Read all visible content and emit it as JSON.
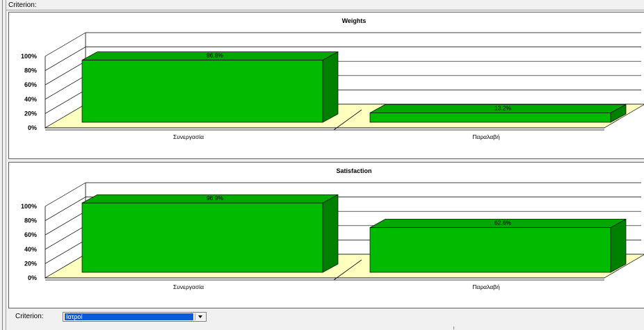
{
  "header": {
    "criterion_label": "Criterion:"
  },
  "footer": {
    "criterion_label": "Criterion:",
    "criterion_value": "Ιατροί"
  },
  "colors": {
    "bar_front": "#00bb00",
    "bar_top": "#00a800",
    "bar_side": "#008000",
    "floor": "#ffffc0"
  },
  "chart_data": [
    {
      "type": "bar",
      "title": "Weights",
      "categories": [
        "Συνεργασία",
        "Παραλαβή"
      ],
      "values": [
        86.8,
        13.2
      ],
      "data_labels": [
        "86.8%",
        "13.2%"
      ],
      "y_ticks": [
        "0%",
        "20%",
        "40%",
        "60%",
        "80%",
        "100%"
      ],
      "ylim": [
        0,
        100
      ],
      "grid": true,
      "three_d": true
    },
    {
      "type": "bar",
      "title": "Satisfaction",
      "categories": [
        "Συνεργασία",
        "Παραλαβή"
      ],
      "values": [
        96.9,
        62.6
      ],
      "data_labels": [
        "96.9%",
        "62.6%"
      ],
      "y_ticks": [
        "0%",
        "20%",
        "40%",
        "60%",
        "80%",
        "100%"
      ],
      "ylim": [
        0,
        100
      ],
      "grid": true,
      "three_d": true
    }
  ]
}
